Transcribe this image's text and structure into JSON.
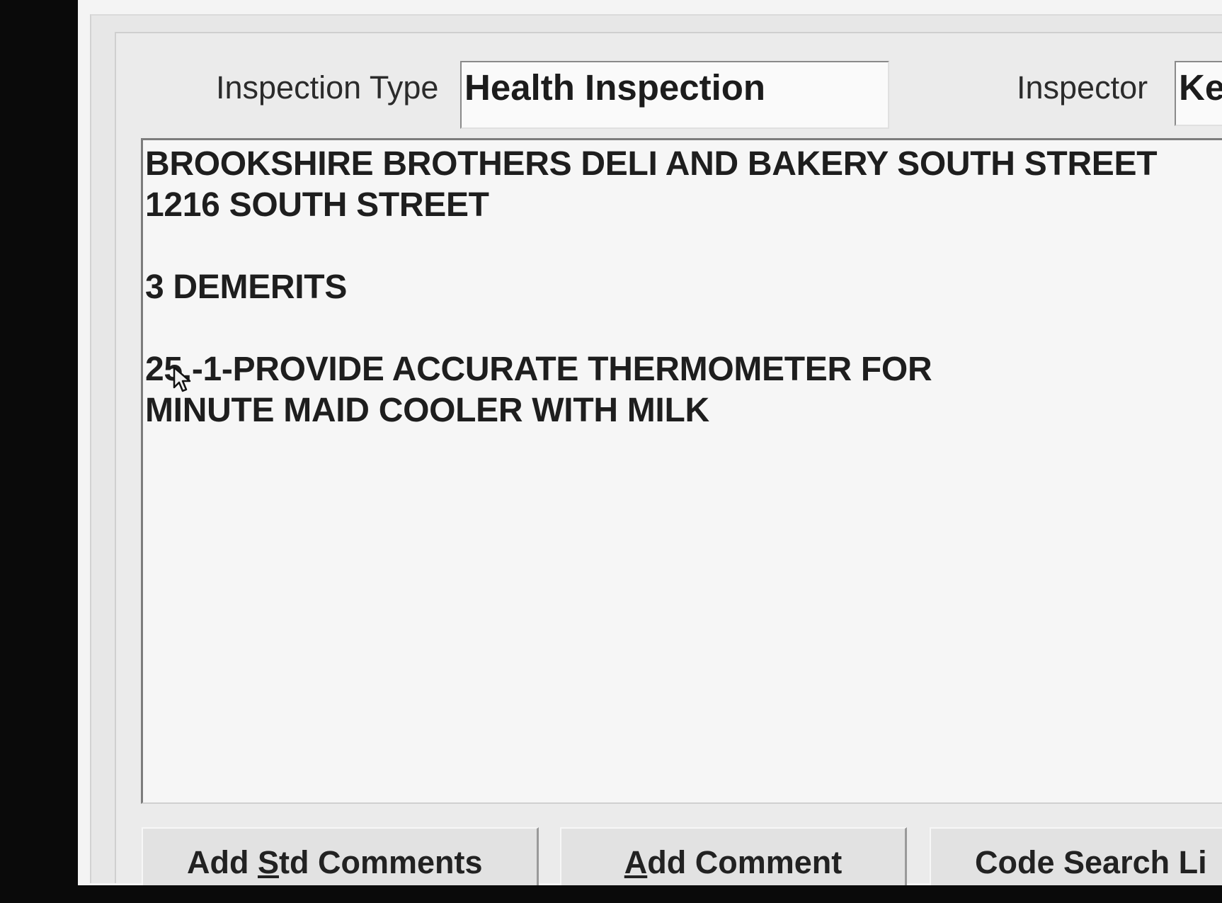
{
  "form": {
    "inspection_type_label": "Inspection Type",
    "inspection_type_value": "Health Inspection",
    "inspector_label": "Inspector",
    "inspector_value": "Ke"
  },
  "comments": {
    "lines": [
      "BROOKSHIRE BROTHERS DELI AND BAKERY SOUTH STREET",
      "1216 SOUTH STREET",
      "",
      "3 DEMERITS",
      "",
      "25.-1-PROVIDE ACCURATE THERMOMETER FOR",
      "MINUTE MAID COOLER WITH MILK"
    ]
  },
  "buttons": {
    "add_std_comments": {
      "pre": "Add ",
      "mnemonic": "S",
      "post": "td Comments"
    },
    "add_comment": {
      "pre": "",
      "mnemonic": "A",
      "post": "dd Comment"
    },
    "code_search": {
      "label": "Code Search Li"
    }
  },
  "icons": {
    "cursor": "mouse-pointer-icon"
  },
  "colors": {
    "panel": "#ebebeb",
    "field": "#fafafa",
    "text": "#1c1c1c",
    "margin": "#0b0b0b"
  }
}
